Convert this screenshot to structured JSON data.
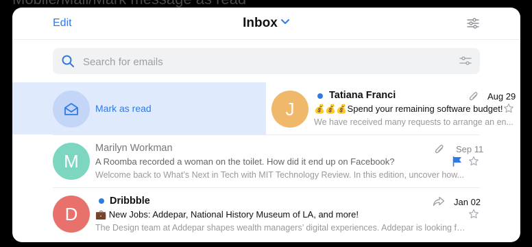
{
  "caption": "Mobile/Mail/Mark message as read",
  "header": {
    "edit_label": "Edit",
    "title": "Inbox"
  },
  "search": {
    "placeholder": "Search for emails"
  },
  "swipe_action": {
    "label": "Mark as read"
  },
  "emails": [
    {
      "initial": "J",
      "avatar_color": "#f0b86b",
      "sender": "Tatiana Franci",
      "unread": true,
      "date": "Aug 29",
      "subject": "💰💰💰Spend your remaining software budget!",
      "preview": "We have received many requests to arrange an en...",
      "attachment": true,
      "flagged": false
    },
    {
      "initial": "M",
      "avatar_color": "#7dd7c0",
      "sender": "Marilyn Workman",
      "unread": false,
      "date": "Sep 11",
      "subject": "A Roomba recorded a woman on the toilet. How did it end up on Facebook?",
      "preview": "Welcome back to What’s Next in Tech with MIT Technology Review. In this edition, uncover how...",
      "attachment": true,
      "flagged": true
    },
    {
      "initial": "D",
      "avatar_color": "#e8726b",
      "sender": "Dribbble",
      "unread": true,
      "date": "Jan 02",
      "subject": "💼 New Jobs: Addepar, National History Museum of LA, and more!",
      "preview": "The Design team at Addepar shapes wealth managers’ digital experiences. Addepar is looking for...",
      "attachment": false,
      "forwarded": true,
      "flagged": false
    }
  ],
  "colors": {
    "accent": "#2f7ae5",
    "flag": "#2f7ae5",
    "swipe_bg": "#dfeafc"
  }
}
